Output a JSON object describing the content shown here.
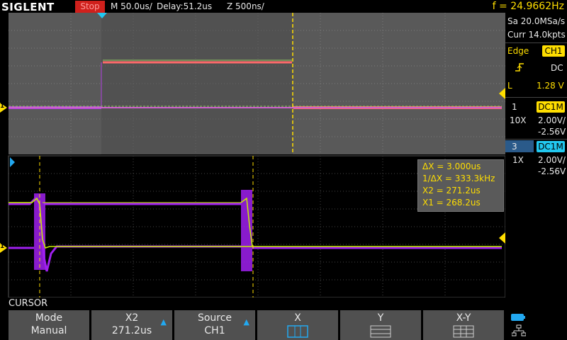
{
  "brand": "SIGLENT",
  "run_state": "Stop",
  "timebase": "M 50.0us/",
  "delay": "Delay:51.2us",
  "zoom_timebase": "Z 500ns/",
  "frequency": "f = 24.9662Hz",
  "acquisition": {
    "sample_rate": "Sa 20.0MSa/s",
    "memory": "Curr 14.0kpts"
  },
  "trigger": {
    "type": "Edge",
    "source": "CH1",
    "coupling": "DC",
    "level_label": "L",
    "level": "1.28 V"
  },
  "channels": [
    {
      "number": "1",
      "coupling": "DC1M",
      "probe": "10X",
      "scale": "2.00V/",
      "offset": "-2.56V",
      "color": "#ffde00"
    },
    {
      "number": "3",
      "coupling": "DC1M",
      "probe": "1X",
      "scale": "2.00V/",
      "offset": "-2.56V",
      "color": "#22c8f0"
    }
  ],
  "cursor_readout": {
    "dx": "ΔX = 3.000us",
    "inv_dx": "1/ΔX = 333.3kHz",
    "x2": "X2 = 271.2us",
    "x1": "X1 = 268.2us"
  },
  "menu_title": "CURSOR",
  "softkeys": [
    {
      "title": "Mode",
      "value": "Manual"
    },
    {
      "title": "X2",
      "value": "271.2us"
    },
    {
      "title": "Source",
      "value": "CH1"
    },
    {
      "title": "X",
      "value": ""
    },
    {
      "title": "Y",
      "value": ""
    },
    {
      "title": "X-Y",
      "value": ""
    }
  ],
  "marker_labels": {
    "ch1_main": "1",
    "ch1_zoom": "1"
  },
  "colors": {
    "ch1": "#ffde00",
    "ch3": "#a020f0",
    "cursor": "#ffde00",
    "trigger": "#d0201c",
    "accent": "#22c8f0"
  }
}
